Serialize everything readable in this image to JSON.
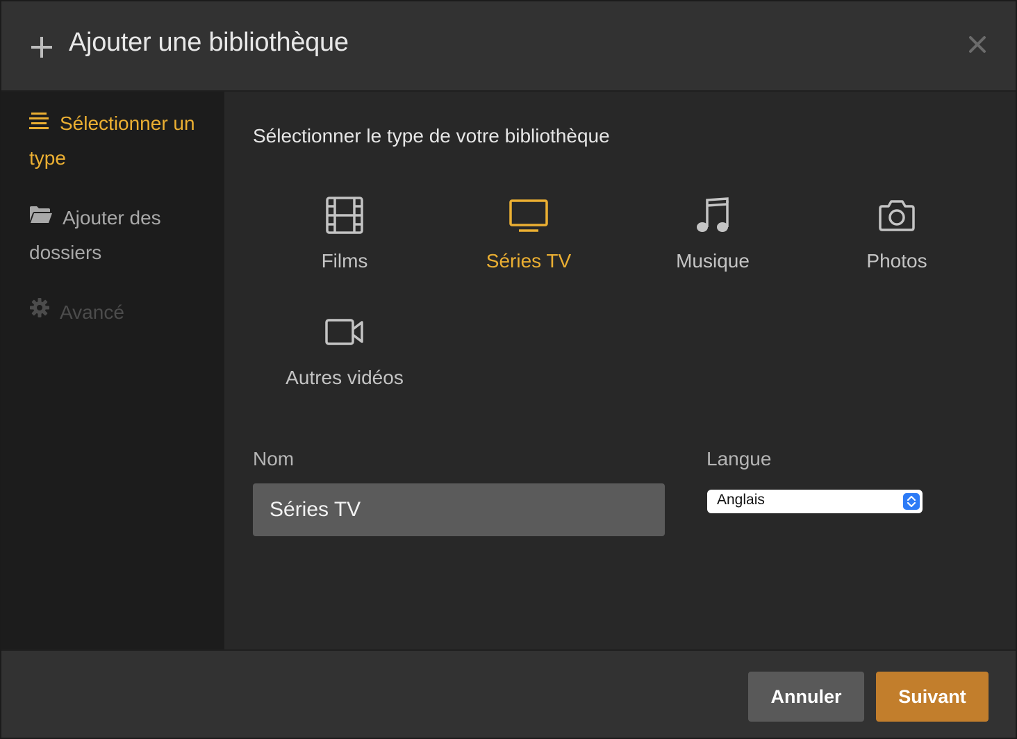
{
  "dialog": {
    "title": "Ajouter une bibliothèque",
    "close_icon": "close-icon",
    "add_icon": "plus-icon"
  },
  "sidebar": {
    "items": [
      {
        "label": "Sélectionner un type",
        "icon": "list-icon",
        "state": "active"
      },
      {
        "label": "Ajouter des dossiers",
        "icon": "folder-icon",
        "state": "normal"
      },
      {
        "label": "Avancé",
        "icon": "gear-icon",
        "state": "disabled"
      }
    ]
  },
  "main": {
    "prompt": "Sélectionner le type de votre bibliothèque",
    "types": [
      {
        "label": "Films",
        "icon": "film-icon",
        "selected": false
      },
      {
        "label": "Séries TV",
        "icon": "tv-icon",
        "selected": true
      },
      {
        "label": "Musique",
        "icon": "music-icon",
        "selected": false
      },
      {
        "label": "Photos",
        "icon": "camera-icon",
        "selected": false
      },
      {
        "label": "Autres vidéos",
        "icon": "video-camera-icon",
        "selected": false
      }
    ],
    "name_field": {
      "label": "Nom",
      "value": "Séries TV"
    },
    "language_field": {
      "label": "Langue",
      "selected": "Anglais"
    }
  },
  "footer": {
    "cancel_label": "Annuler",
    "next_label": "Suivant"
  },
  "colors": {
    "accent": "#ebaf32",
    "primary_button": "#c27e2c",
    "secondary_button": "#595959",
    "select_stepper": "#2d7bf6"
  }
}
